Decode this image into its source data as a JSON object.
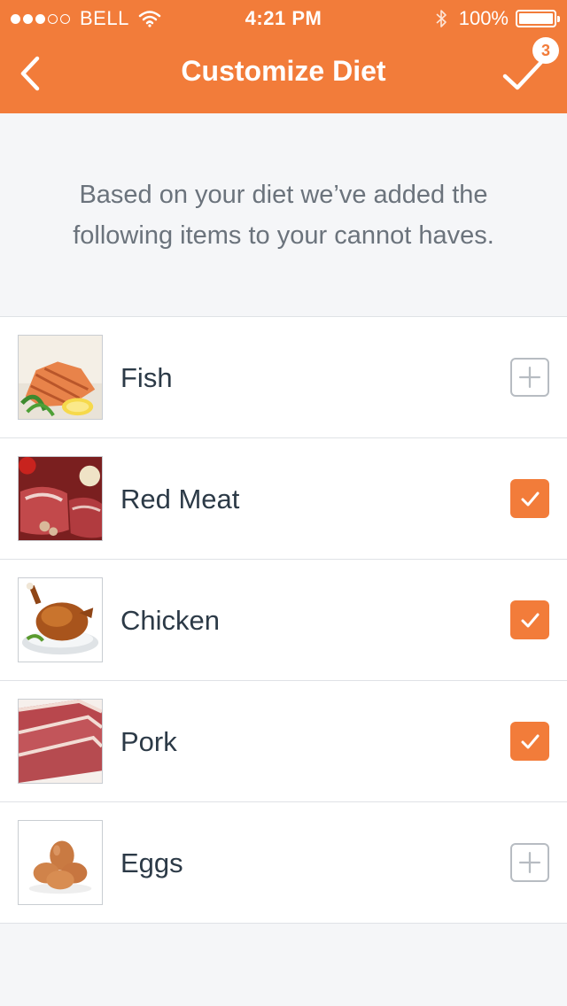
{
  "status_bar": {
    "carrier": "BELL",
    "time": "4:21 PM",
    "battery": "100%"
  },
  "header": {
    "title": "Customize Diet",
    "badge_count": "3",
    "accent_color": "#f27c3a"
  },
  "intro_text": "Based on your diet we’ve added the following items to your cannot haves.",
  "items": [
    {
      "label": "Fish",
      "state": "add",
      "image": "fish-photo"
    },
    {
      "label": "Red Meat",
      "state": "checked",
      "image": "red-meat-photo"
    },
    {
      "label": "Chicken",
      "state": "checked",
      "image": "chicken-photo"
    },
    {
      "label": "Pork",
      "state": "checked",
      "image": "pork-photo"
    },
    {
      "label": "Eggs",
      "state": "add",
      "image": "eggs-photo"
    }
  ],
  "icons": {
    "back": "chevron-left-icon",
    "done": "checkmark-icon",
    "add": "plus-icon",
    "checked": "checkbox-checked-icon"
  }
}
